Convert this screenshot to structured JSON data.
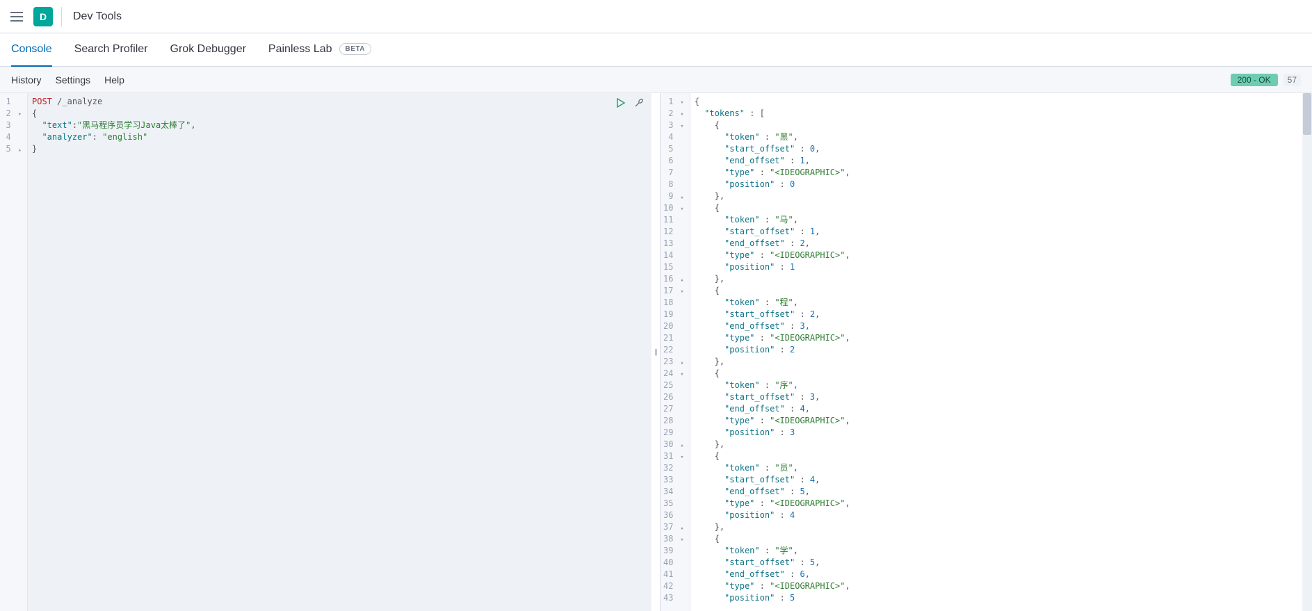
{
  "header": {
    "logo_letter": "D",
    "title": "Dev Tools"
  },
  "tabs": [
    {
      "label": "Console",
      "active": true
    },
    {
      "label": "Search Profiler",
      "active": false
    },
    {
      "label": "Grok Debugger",
      "active": false
    },
    {
      "label": "Painless Lab",
      "active": false,
      "badge": "BETA"
    }
  ],
  "subbar": {
    "items": [
      "History",
      "Settings",
      "Help"
    ],
    "status": "200 - OK",
    "status_extra": "57"
  },
  "request": {
    "method": "POST",
    "path": "/_analyze",
    "body_text": "黑马程序员学习Java太棒了",
    "body_analyzer": "english",
    "lines": [
      {
        "n": 1,
        "fold": "",
        "raw": "<span class='kw'>POST</span> <span class='punc'>/_analyze</span>"
      },
      {
        "n": 2,
        "fold": "▾",
        "raw": "<span class='punc'>{</span>"
      },
      {
        "n": 3,
        "fold": "",
        "raw": "  <span class='key'>\"text\"</span><span class='punc'>:</span><span class='str'>\"黑马程序员学习Java太棒了\"</span><span class='punc'>,</span>"
      },
      {
        "n": 4,
        "fold": "",
        "raw": "  <span class='key'>\"analyzer\"</span><span class='punc'>:</span> <span class='str'>\"english\"</span>"
      },
      {
        "n": 5,
        "fold": "▴",
        "raw": "<span class='punc'>}</span>"
      }
    ]
  },
  "response": {
    "raw_lines": [
      {
        "n": 1,
        "fold": "▾",
        "t": "{"
      },
      {
        "n": 2,
        "fold": "▾",
        "t": "  \"tokens\" : ["
      },
      {
        "n": 3,
        "fold": "▾",
        "t": "    {"
      },
      {
        "n": 4,
        "fold": "",
        "t": "      \"token\" : \"黑\","
      },
      {
        "n": 5,
        "fold": "",
        "t": "      \"start_offset\" : 0,"
      },
      {
        "n": 6,
        "fold": "",
        "t": "      \"end_offset\" : 1,"
      },
      {
        "n": 7,
        "fold": "",
        "t": "      \"type\" : \"<IDEOGRAPHIC>\","
      },
      {
        "n": 8,
        "fold": "",
        "t": "      \"position\" : 0"
      },
      {
        "n": 9,
        "fold": "▴",
        "t": "    },"
      },
      {
        "n": 10,
        "fold": "▾",
        "t": "    {"
      },
      {
        "n": 11,
        "fold": "",
        "t": "      \"token\" : \"马\","
      },
      {
        "n": 12,
        "fold": "",
        "t": "      \"start_offset\" : 1,"
      },
      {
        "n": 13,
        "fold": "",
        "t": "      \"end_offset\" : 2,"
      },
      {
        "n": 14,
        "fold": "",
        "t": "      \"type\" : \"<IDEOGRAPHIC>\","
      },
      {
        "n": 15,
        "fold": "",
        "t": "      \"position\" : 1"
      },
      {
        "n": 16,
        "fold": "▴",
        "t": "    },"
      },
      {
        "n": 17,
        "fold": "▾",
        "t": "    {"
      },
      {
        "n": 18,
        "fold": "",
        "t": "      \"token\" : \"程\","
      },
      {
        "n": 19,
        "fold": "",
        "t": "      \"start_offset\" : 2,"
      },
      {
        "n": 20,
        "fold": "",
        "t": "      \"end_offset\" : 3,"
      },
      {
        "n": 21,
        "fold": "",
        "t": "      \"type\" : \"<IDEOGRAPHIC>\","
      },
      {
        "n": 22,
        "fold": "",
        "t": "      \"position\" : 2"
      },
      {
        "n": 23,
        "fold": "▴",
        "t": "    },"
      },
      {
        "n": 24,
        "fold": "▾",
        "t": "    {"
      },
      {
        "n": 25,
        "fold": "",
        "t": "      \"token\" : \"序\","
      },
      {
        "n": 26,
        "fold": "",
        "t": "      \"start_offset\" : 3,"
      },
      {
        "n": 27,
        "fold": "",
        "t": "      \"end_offset\" : 4,"
      },
      {
        "n": 28,
        "fold": "",
        "t": "      \"type\" : \"<IDEOGRAPHIC>\","
      },
      {
        "n": 29,
        "fold": "",
        "t": "      \"position\" : 3"
      },
      {
        "n": 30,
        "fold": "▴",
        "t": "    },"
      },
      {
        "n": 31,
        "fold": "▾",
        "t": "    {"
      },
      {
        "n": 32,
        "fold": "",
        "t": "      \"token\" : \"员\","
      },
      {
        "n": 33,
        "fold": "",
        "t": "      \"start_offset\" : 4,"
      },
      {
        "n": 34,
        "fold": "",
        "t": "      \"end_offset\" : 5,"
      },
      {
        "n": 35,
        "fold": "",
        "t": "      \"type\" : \"<IDEOGRAPHIC>\","
      },
      {
        "n": 36,
        "fold": "",
        "t": "      \"position\" : 4"
      },
      {
        "n": 37,
        "fold": "▴",
        "t": "    },"
      },
      {
        "n": 38,
        "fold": "▾",
        "t": "    {"
      },
      {
        "n": 39,
        "fold": "",
        "t": "      \"token\" : \"学\","
      },
      {
        "n": 40,
        "fold": "",
        "t": "      \"start_offset\" : 5,"
      },
      {
        "n": 41,
        "fold": "",
        "t": "      \"end_offset\" : 6,"
      },
      {
        "n": 42,
        "fold": "",
        "t": "      \"type\" : \"<IDEOGRAPHIC>\","
      },
      {
        "n": 43,
        "fold": "",
        "t": "      \"position\" : 5"
      }
    ]
  }
}
